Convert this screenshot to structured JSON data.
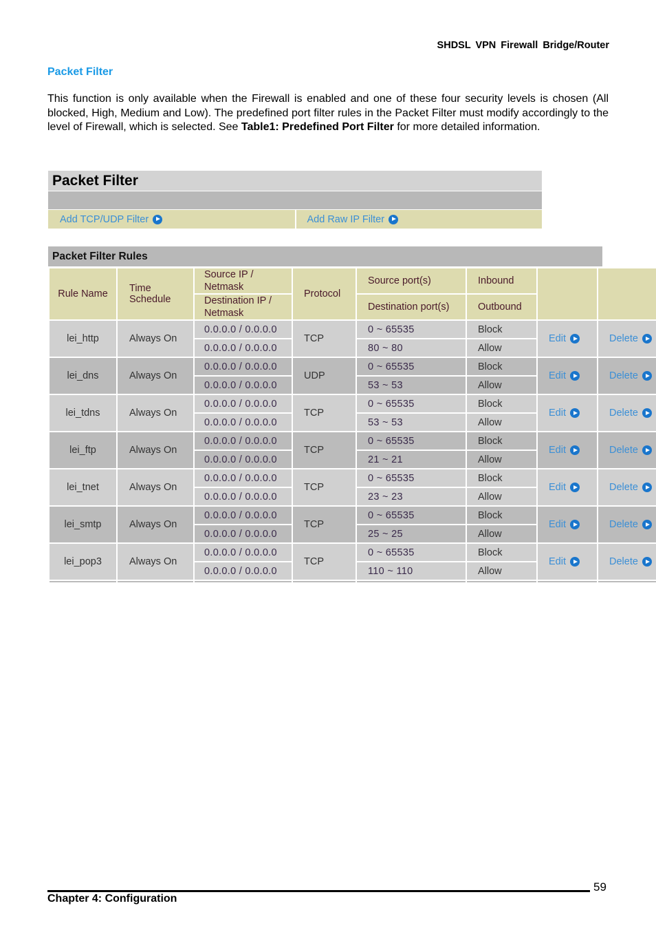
{
  "header": {
    "product": "SHDSL  VPN  Firewall  Bridge/Router"
  },
  "section": {
    "title": "Packet Filter",
    "intro_before": "This function is only available when the Firewall is enabled and one of these four security levels is chosen (All blocked, High, Medium and Low).   The predefined port filter rules in the Packet Filter must modify accordingly to the level of Firewall, which is selected.   See ",
    "intro_bold": "Table1: Predefined Port Filter",
    "intro_after": " for more detailed information."
  },
  "panel": {
    "title": "Packet Filter",
    "add_tcp_udp": "Add TCP/UDP Filter",
    "add_raw_ip": "Add Raw IP Filter"
  },
  "rules": {
    "title": "Packet Filter Rules",
    "headers": {
      "rule_name": "Rule Name",
      "time_schedule": "Time Schedule",
      "source_ip": "Source IP / Netmask",
      "dest_ip": "Destination IP / Netmask",
      "protocol": "Protocol",
      "source_ports": "Source port(s)",
      "dest_ports": "Destination port(s)",
      "inbound": "Inbound",
      "outbound": "Outbound"
    },
    "edit_label": "Edit",
    "delete_label": "Delete",
    "rows": [
      {
        "name": "lei_http",
        "schedule": "Always On",
        "src_ip": "0.0.0.0 / 0.0.0.0",
        "dst_ip": "0.0.0.0 / 0.0.0.0",
        "protocol": "TCP",
        "src_port": "0 ~ 65535",
        "dst_port": "80 ~ 80",
        "inbound": "Block",
        "outbound": "Allow"
      },
      {
        "name": "lei_dns",
        "schedule": "Always On",
        "src_ip": "0.0.0.0 / 0.0.0.0",
        "dst_ip": "0.0.0.0 / 0.0.0.0",
        "protocol": "UDP",
        "src_port": "0 ~ 65535",
        "dst_port": "53 ~ 53",
        "inbound": "Block",
        "outbound": "Allow"
      },
      {
        "name": "lei_tdns",
        "schedule": "Always On",
        "src_ip": "0.0.0.0 / 0.0.0.0",
        "dst_ip": "0.0.0.0 / 0.0.0.0",
        "protocol": "TCP",
        "src_port": "0 ~ 65535",
        "dst_port": "53 ~ 53",
        "inbound": "Block",
        "outbound": "Allow"
      },
      {
        "name": "lei_ftp",
        "schedule": "Always On",
        "src_ip": "0.0.0.0 / 0.0.0.0",
        "dst_ip": "0.0.0.0 / 0.0.0.0",
        "protocol": "TCP",
        "src_port": "0 ~ 65535",
        "dst_port": "21 ~ 21",
        "inbound": "Block",
        "outbound": "Allow"
      },
      {
        "name": "lei_tnet",
        "schedule": "Always On",
        "src_ip": "0.0.0.0 / 0.0.0.0",
        "dst_ip": "0.0.0.0 / 0.0.0.0",
        "protocol": "TCP",
        "src_port": "0 ~ 65535",
        "dst_port": "23 ~ 23",
        "inbound": "Block",
        "outbound": "Allow"
      },
      {
        "name": "lei_smtp",
        "schedule": "Always On",
        "src_ip": "0.0.0.0 / 0.0.0.0",
        "dst_ip": "0.0.0.0 / 0.0.0.0",
        "protocol": "TCP",
        "src_port": "0 ~ 65535",
        "dst_port": "25 ~ 25",
        "inbound": "Block",
        "outbound": "Allow"
      },
      {
        "name": "lei_pop3",
        "schedule": "Always On",
        "src_ip": "0.0.0.0 / 0.0.0.0",
        "dst_ip": "0.0.0.0 / 0.0.0.0",
        "protocol": "TCP",
        "src_port": "0 ~ 65535",
        "dst_port": "110 ~ 110",
        "inbound": "Block",
        "outbound": "Allow"
      }
    ]
  },
  "footer": {
    "page": "59",
    "chapter": "Chapter 4: Configuration"
  },
  "colors": {
    "accent": "#1a9ae6",
    "link": "#3b8fd6",
    "header_bg": "#dddbaf",
    "row_light": "#d0d0d0",
    "row_dark": "#bbbbbb"
  }
}
